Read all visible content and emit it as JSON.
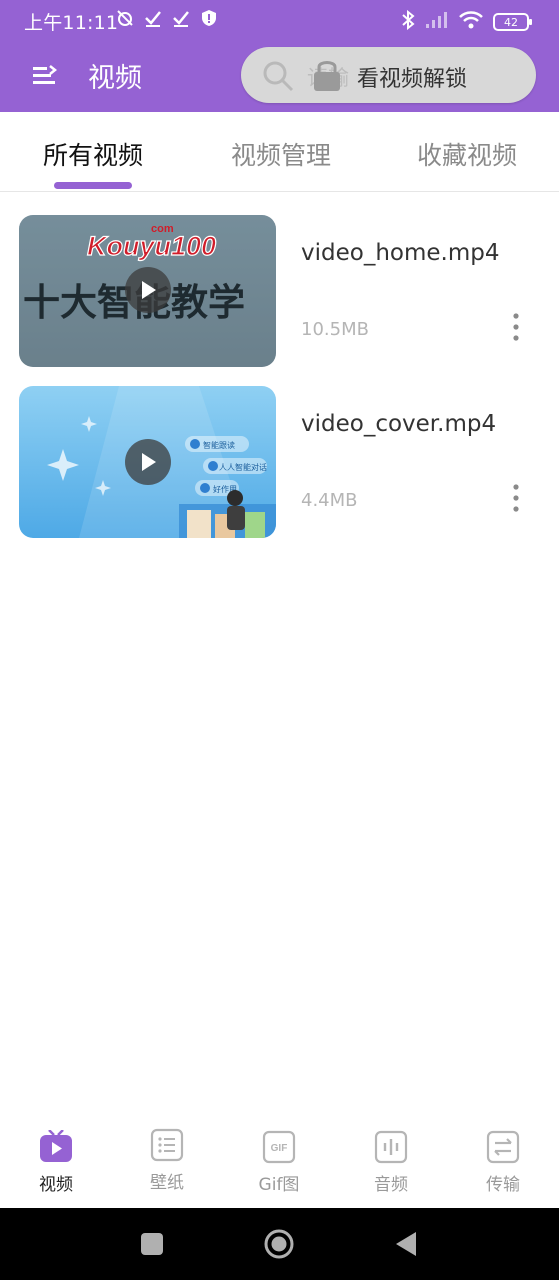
{
  "status_bar": {
    "time": "上午11:11",
    "battery": "42"
  },
  "app_bar": {
    "title": "视频",
    "search_placeholder": "请输",
    "search_label": "看视频解锁"
  },
  "tabs": [
    {
      "label": "所有视频",
      "active": true
    },
    {
      "label": "视频管理",
      "active": false
    },
    {
      "label": "收藏视频",
      "active": false
    }
  ],
  "videos": [
    {
      "name": "video_home.mp4",
      "size": "10.5MB",
      "thumbnail_logo": "Kouyu100",
      "thumbnail_logo_small": "com",
      "thumbnail_caption": "十大智能教学"
    },
    {
      "name": "video_cover.mp4",
      "size": "4.4MB",
      "thumbnail_chips": [
        "智能跟读",
        "人人智能对话",
        "好作用"
      ]
    }
  ],
  "bottom_nav": [
    {
      "label": "视频",
      "icon": "video-play-icon",
      "active": true
    },
    {
      "label": "壁纸",
      "icon": "wallpaper-list-icon",
      "active": false
    },
    {
      "label": "Gif图",
      "icon": "gif-icon",
      "active": false
    },
    {
      "label": "音频",
      "icon": "audio-wave-icon",
      "active": false
    },
    {
      "label": "传输",
      "icon": "transfer-icon",
      "active": false
    }
  ],
  "colors": {
    "accent": "#9562d3",
    "header_bg": "#9562d3"
  }
}
